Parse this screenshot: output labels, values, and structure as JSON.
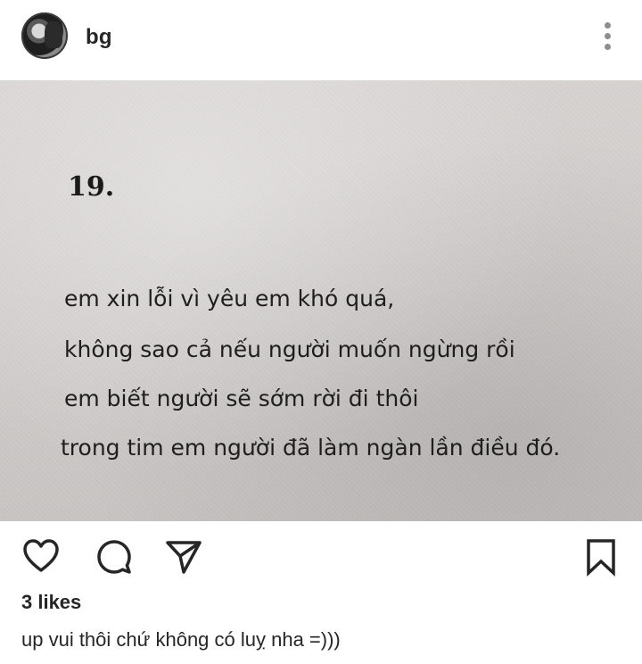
{
  "header": {
    "username": "bg"
  },
  "photo": {
    "page_number": "19.",
    "lines": [
      "em xin lỗi vì yêu em khó quá,",
      "không sao cả nếu người muốn ngừng rồi",
      "em biết người sẽ sớm rời đi thôi",
      "trong tim em người đã làm ngàn lần điều đó."
    ]
  },
  "actions": {
    "like_icon": "heart-icon",
    "comment_icon": "comment-bubble-icon",
    "share_icon": "paper-plane-icon",
    "save_icon": "bookmark-icon"
  },
  "likes": "3 likes",
  "caption": "up vui thôi chứ không có luỵ nha =)))"
}
